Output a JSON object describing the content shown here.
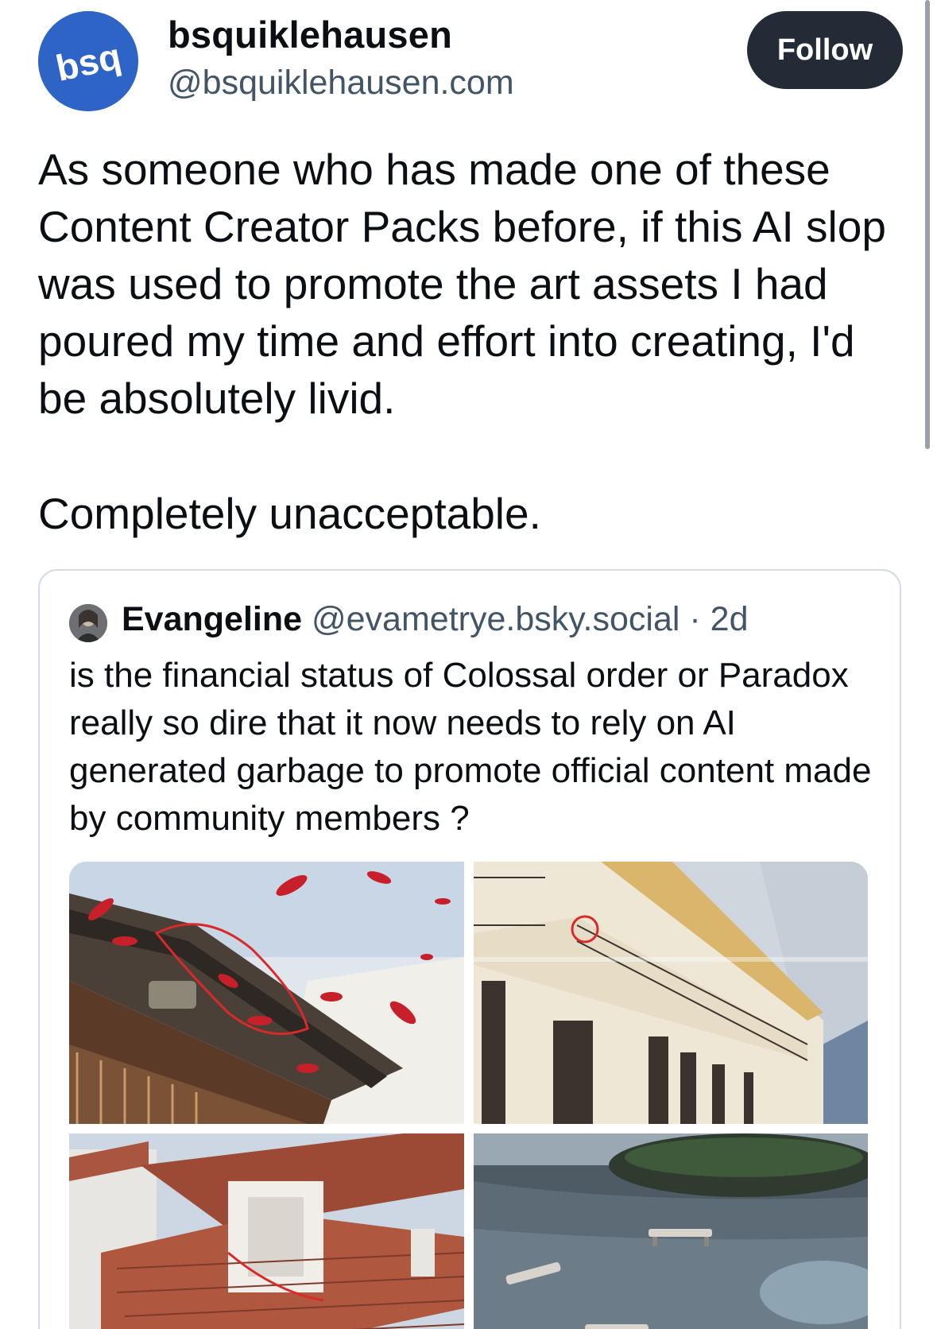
{
  "post": {
    "author_name": "bsquiklehausen",
    "author_handle": "@bsquiklehausen.com",
    "avatar_text": "bsq",
    "follow_label": "Follow",
    "text_paragraph_1": "As someone who has made one of these Content Creator Packs before, if this AI slop was used to promote the art assets I had poured my time and effort into creating, I'd be absolutely livid.",
    "text_paragraph_2": "Completely unacceptable."
  },
  "quote": {
    "author_name": "Evangeline",
    "author_handle": "@evametrye.bsky.social",
    "separator": " · ",
    "age": "2d",
    "text": "is the financial status of Colossal order or Paradox really so dire that it now needs to rely on AI generated garbage to promote official content made by community members ?",
    "images": [
      {
        "name": "image-red-leaves-roof"
      },
      {
        "name": "image-balcony-villa"
      },
      {
        "name": "image-tiled-roofs"
      },
      {
        "name": "image-plaza-benches"
      }
    ]
  },
  "colors": {
    "follow_button_bg": "#232b36",
    "avatar_bg": "#2f64c7",
    "handle_text": "#425466",
    "card_border": "#d4dbe2",
    "annotation_red": "#d92a2a"
  }
}
